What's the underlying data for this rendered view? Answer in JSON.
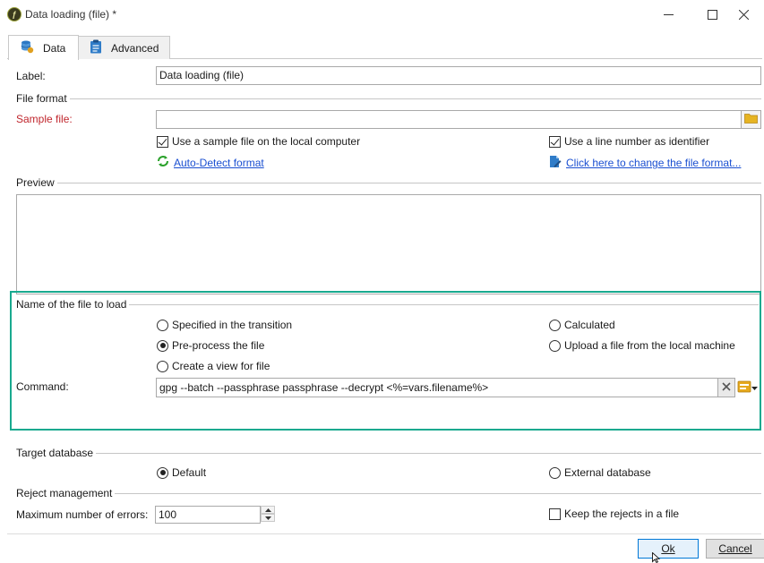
{
  "window": {
    "title": "Data loading (file) *"
  },
  "tabs": [
    {
      "label": "Data",
      "icon": "database-icon",
      "active": true
    },
    {
      "label": "Advanced",
      "icon": "clipboard-icon",
      "active": false
    }
  ],
  "label_field": {
    "label": "Label:",
    "value": "Data loading (file)"
  },
  "file_format": {
    "section": "File format",
    "sample_file_label": "Sample file:",
    "sample_file_value": "",
    "use_sample_local": {
      "label": "Use a sample file on the local computer",
      "checked": true
    },
    "use_line_number": {
      "label": "Use a line number as identifier",
      "checked": true
    },
    "auto_detect_link": "Auto-Detect format",
    "change_format_link": "Click here to change the file format..."
  },
  "preview": {
    "section": "Preview"
  },
  "file_to_load": {
    "section": "Name of the file to load",
    "options": {
      "specified": "Specified in the transition",
      "calculated": "Calculated",
      "preprocess": "Pre-process the file",
      "upload": "Upload a file from the local machine",
      "create_view": "Create a view for file"
    },
    "selected": "preprocess",
    "command_label": "Command:",
    "command_value": "gpg --batch --passphrase passphrase --decrypt <%=vars.filename%>"
  },
  "target_database": {
    "section": "Target database",
    "default": "Default",
    "external": "External database",
    "selected": "default"
  },
  "reject_management": {
    "section": "Reject management",
    "max_errors_label": "Maximum number of errors:",
    "max_errors_value": "100",
    "keep_rejects": {
      "label": "Keep the rejects in a file",
      "checked": false
    }
  },
  "buttons": {
    "ok": "Ok",
    "cancel": "Cancel"
  },
  "colors": {
    "highlight": "#19a98f",
    "required_label": "#c0262d",
    "link": "#1a4fd1"
  }
}
